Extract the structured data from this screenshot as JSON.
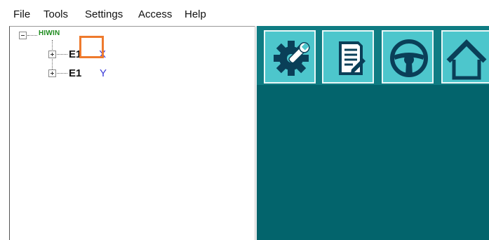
{
  "menu": {
    "items": [
      "File",
      "Tools",
      "Settings",
      "Access",
      "Help"
    ]
  },
  "tree": {
    "root_label": "HIWIN",
    "nodes": [
      {
        "label": "E1",
        "axis": "X"
      },
      {
        "label": "E1",
        "axis": "Y"
      }
    ]
  },
  "toolbar": {
    "buttons": [
      "settings-wrench-icon",
      "document-edit-icon",
      "steering-wheel-icon",
      "home-icon"
    ]
  },
  "colors": {
    "workspace_bg": "#03646c",
    "toolbar_bg": "#0f7c83",
    "button_bg": "#4dc6cc",
    "highlight": "#ee7a2d",
    "root_label": "#1e8c1e",
    "axis_text": "#3a3ad8"
  }
}
